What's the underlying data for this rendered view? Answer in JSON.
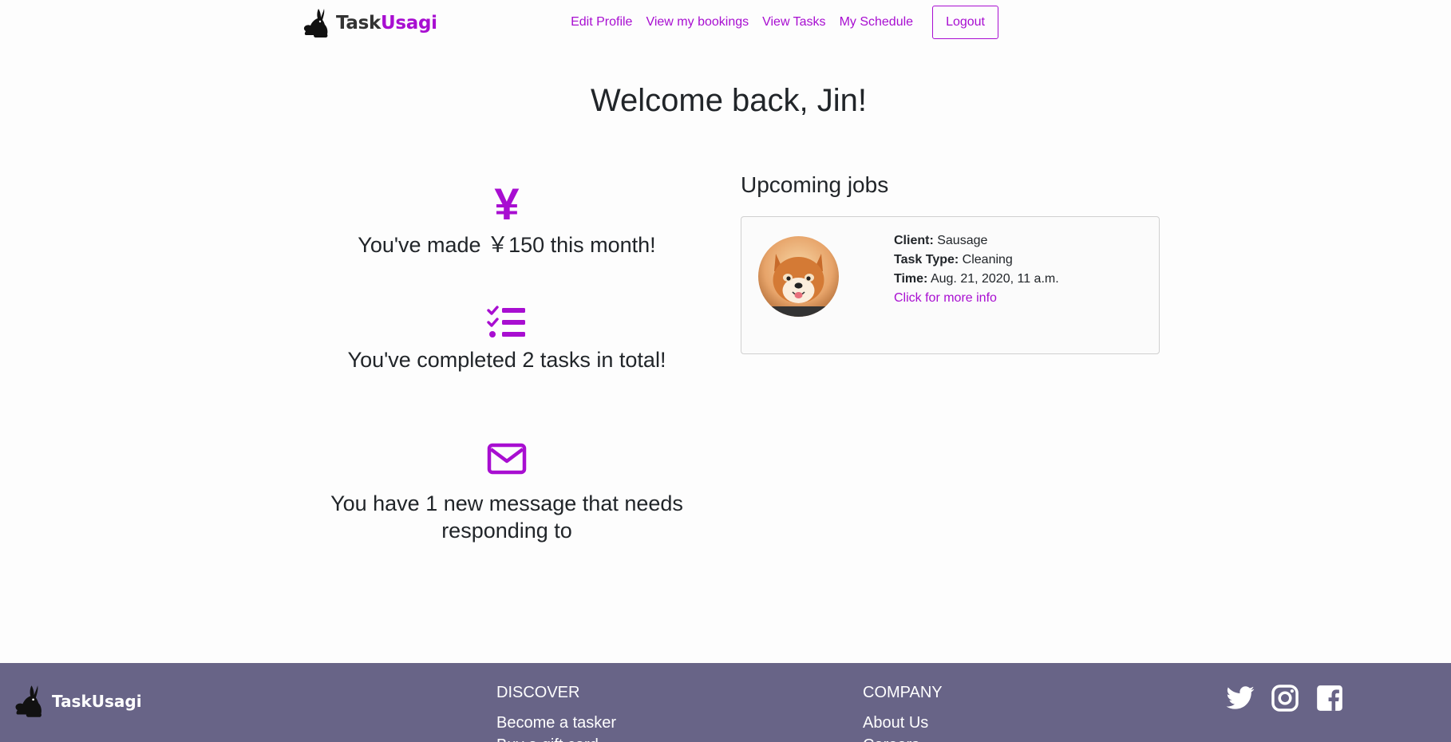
{
  "brand": {
    "name_part1": "Task",
    "name_part2": "Usagi",
    "accent": "#a80ed1"
  },
  "nav": {
    "links": [
      "Edit Profile",
      "View my bookings",
      "View Tasks",
      "My Schedule"
    ],
    "logout": "Logout"
  },
  "welcome": "Welcome back, Jin!",
  "stats": {
    "earnings": {
      "icon": "yen-icon",
      "glyph": "¥",
      "text": "You've made ￥150 this month!"
    },
    "tasks": {
      "icon": "task-list-icon",
      "text": "You've completed 2 tasks in total!"
    },
    "messages": {
      "icon": "envelope-icon",
      "text": "You have 1 new message that needs responding to"
    }
  },
  "upcoming": {
    "title": "Upcoming jobs",
    "job": {
      "client_label": "Client:",
      "client": "Sausage",
      "type_label": "Task Type:",
      "type": "Cleaning",
      "time_label": "Time:",
      "time": "Aug. 21, 2020, 11 a.m.",
      "more": "Click for more info"
    }
  },
  "footer": {
    "brand": "TaskUsagi",
    "bg": "#686487",
    "discover": {
      "title": "DISCOVER",
      "links": [
        "Become a tasker",
        "Buy a gift card"
      ]
    },
    "company": {
      "title": "COMPANY",
      "links": [
        "About Us",
        "Careers"
      ]
    },
    "socials": [
      "twitter-icon",
      "instagram-icon",
      "facebook-icon"
    ]
  }
}
